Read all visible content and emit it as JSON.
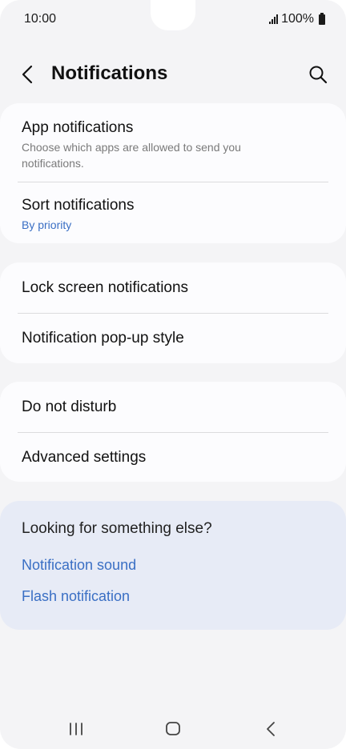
{
  "status_bar": {
    "time": "10:00",
    "battery": "100%",
    "icons": [
      "signal-icon",
      "battery-icon"
    ]
  },
  "header": {
    "title": "Notifications",
    "back_icon": "chevron-left-icon",
    "search_icon": "search-icon"
  },
  "groups": [
    {
      "items": [
        {
          "title": "App notifications",
          "subtitle": "Choose which apps are allowed to send you notifications."
        },
        {
          "title": "Sort notifications",
          "value": "By priority"
        }
      ]
    },
    {
      "items": [
        {
          "title": "Lock screen notifications"
        },
        {
          "title": "Notification pop-up style"
        }
      ]
    },
    {
      "items": [
        {
          "title": "Do not disturb"
        },
        {
          "title": "Advanced settings"
        }
      ]
    }
  ],
  "suggestions": {
    "title": "Looking for something else?",
    "links": [
      "Notification sound",
      "Flash notification"
    ]
  },
  "nav_bar": {
    "icons": [
      "recent-apps-icon",
      "home-icon",
      "back-icon"
    ]
  },
  "colors": {
    "background": "#f4f4f6",
    "card": "#fcfcfe",
    "suggest_card": "#e7ebf6",
    "accent": "#3a6fc4",
    "text": "#111111",
    "secondary_text": "#7a7a7a"
  }
}
